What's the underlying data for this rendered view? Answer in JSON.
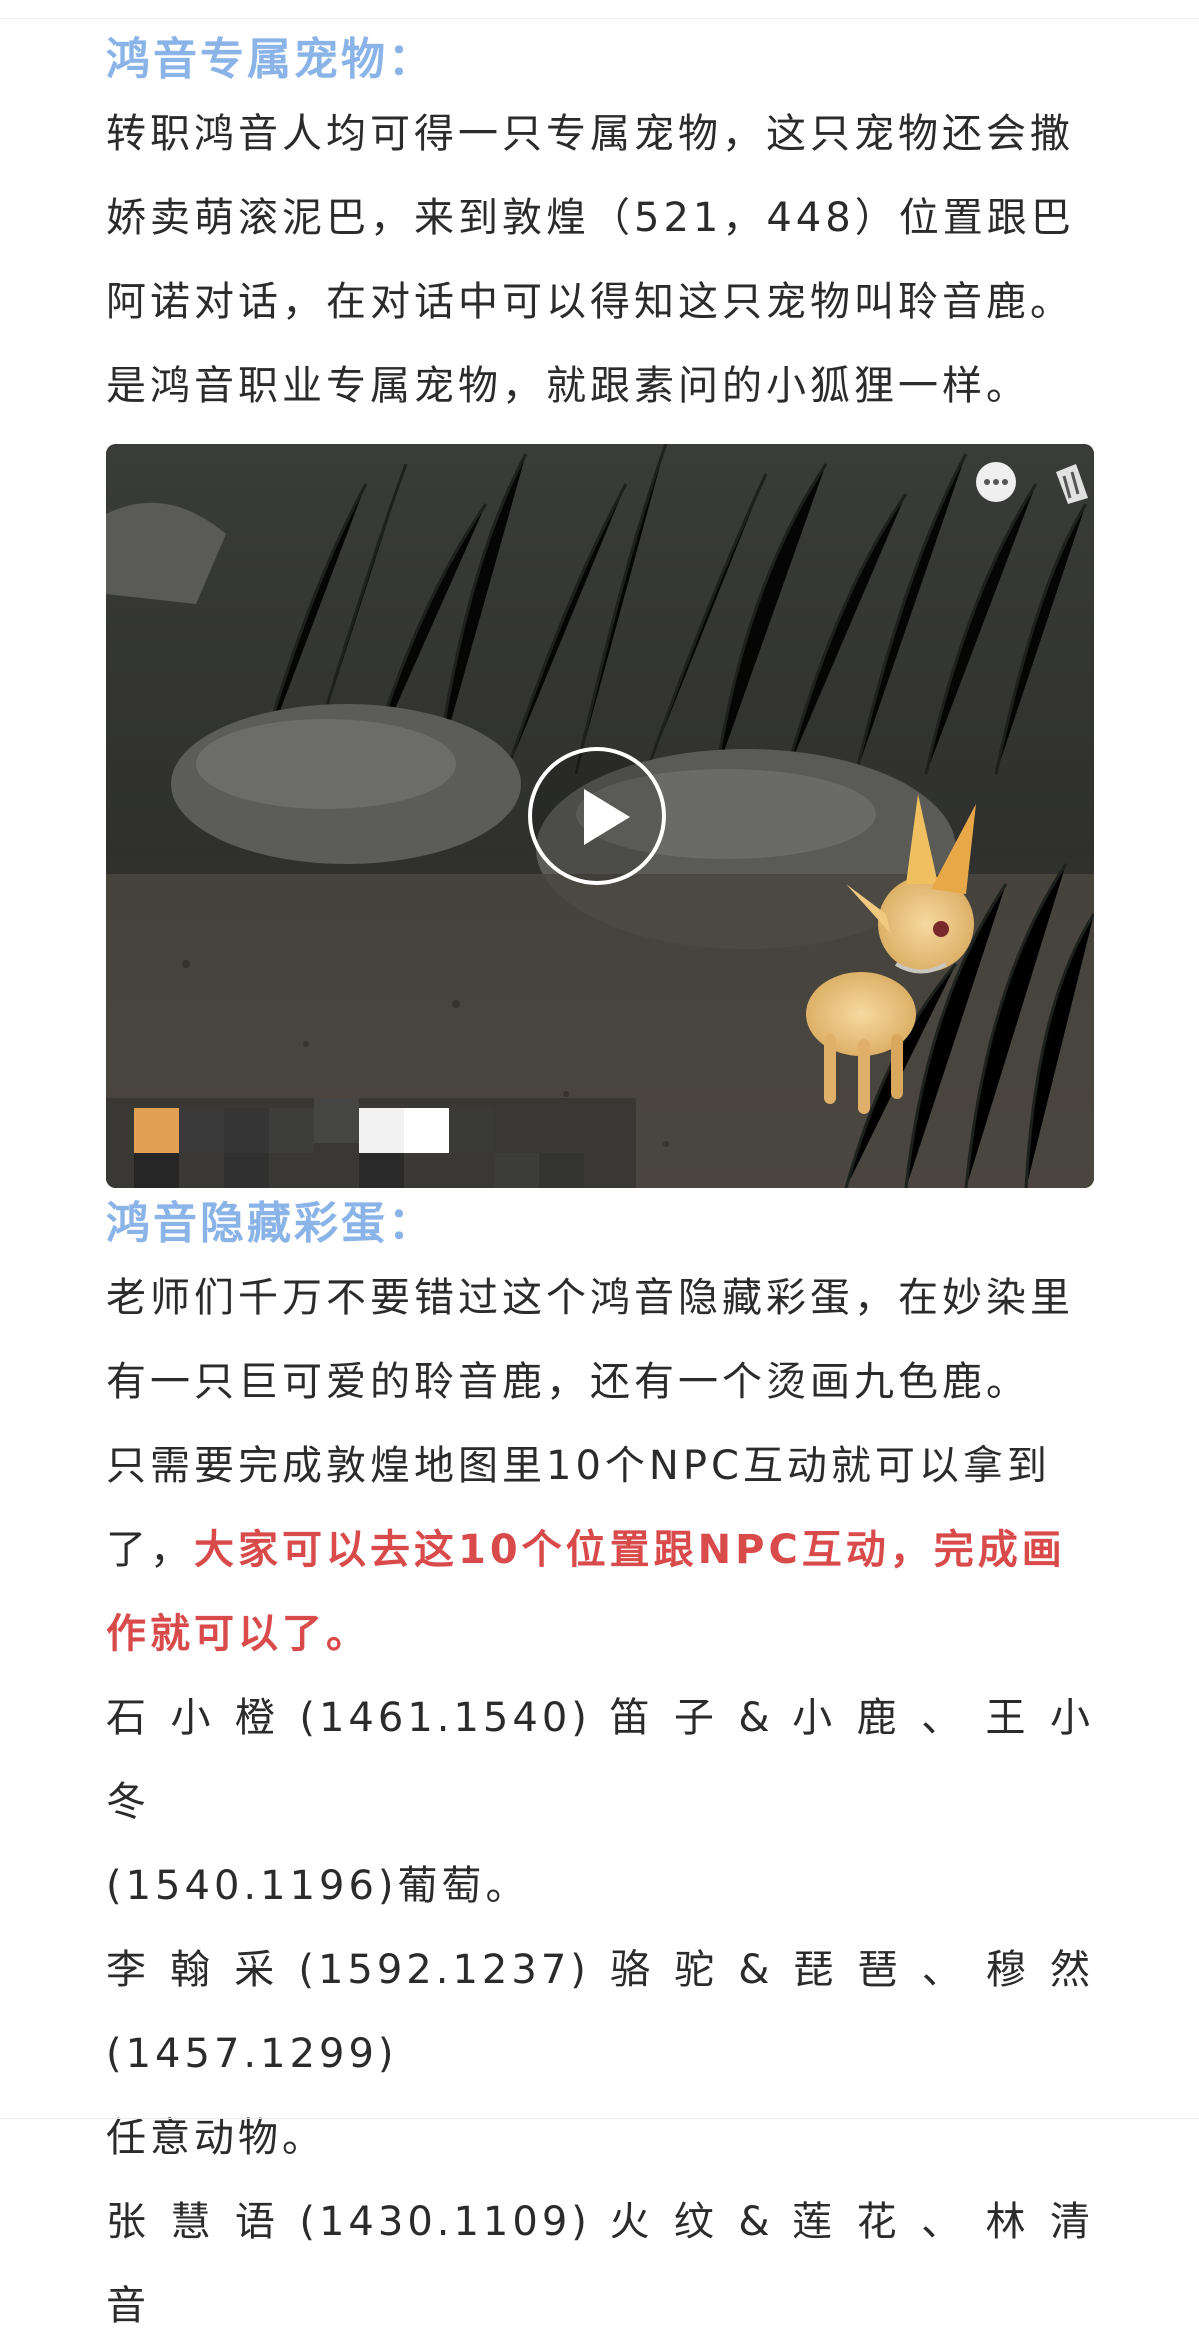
{
  "section1": {
    "heading": "鸿音专属宠物：",
    "lines": [
      "转职鸿音人均可得一只专属宠物，这只宠物还会撒",
      "娇卖萌滚泥巴，来到敦煌（521，448）位置跟巴",
      "阿诺对话，在对话中可以得知这只宠物叫聆音鹿。",
      "是鸿音职业专属宠物，就跟素问的小狐狸一样。"
    ]
  },
  "video": {
    "play_icon": "play-icon",
    "more_icon": "more-dots-icon",
    "corner_icon": "stack-icon"
  },
  "section2": {
    "heading": "鸿音隐藏彩蛋：",
    "lines": [
      "老师们千万不要错过这个鸿音隐藏彩蛋，在妙染里",
      "有一只巨可爱的聆音鹿，还有一个烫画九色鹿。",
      "只需要完成敦煌地图里10个NPC互动就可以拿到"
    ],
    "line4_start": "了，",
    "line4_red": "大家可以去这10个位置跟NPC互动，完成画",
    "line5_red": "作就可以了。",
    "npc_lines": [
      "石 小 橙 (1461.1540) 笛 子 & 小 鹿 、 王 小 冬",
      "(1540.1196)葡萄。",
      "李翰采(1592.1237)骆驼&琵琶、穆然 (1457.1299)",
      "任意动物。",
      "张 慧 语 (1430.1109) 火 纹 & 莲 花 、 林 清 音"
    ]
  },
  "colors": {
    "heading": "#8ab4e8",
    "emphasis": "#d94a4a",
    "text": "#2b2b2b"
  }
}
